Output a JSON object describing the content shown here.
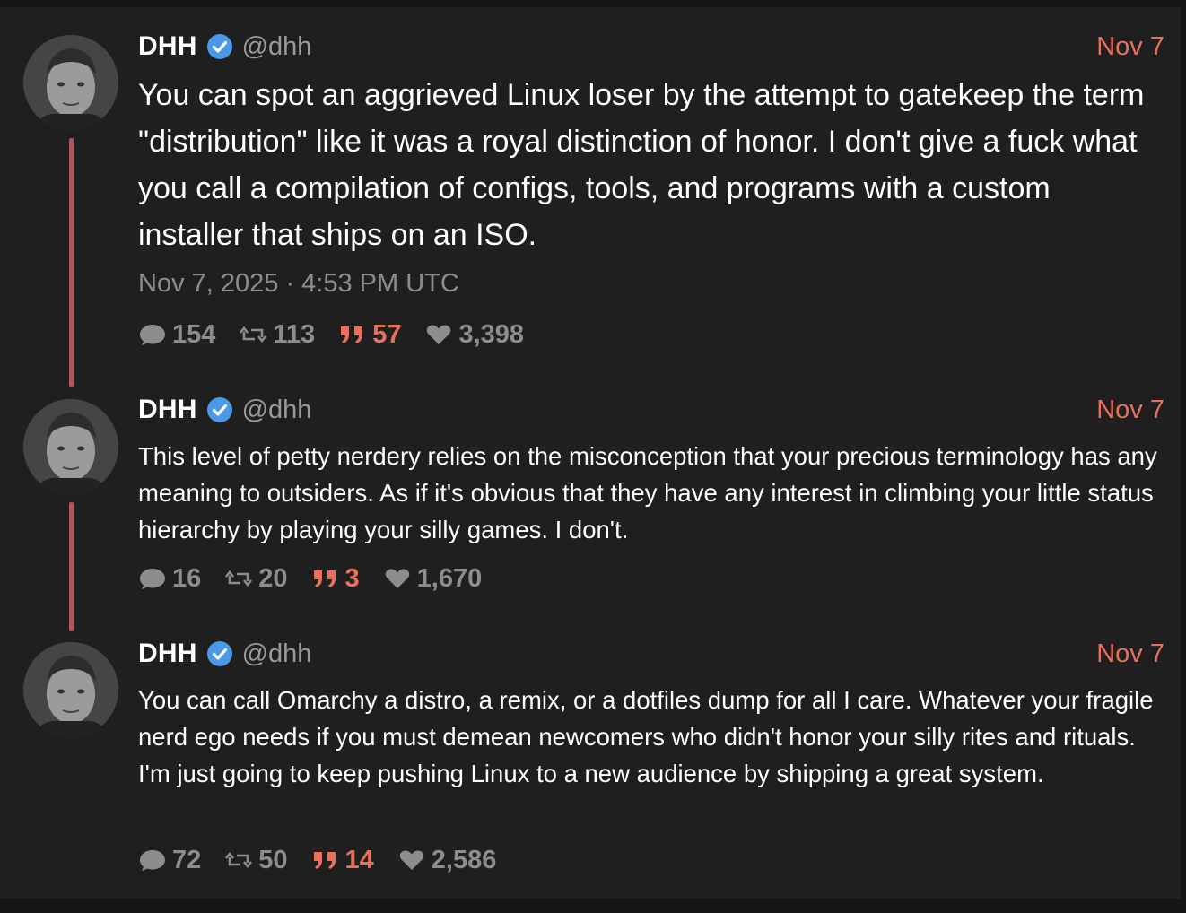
{
  "author": {
    "name": "DHH",
    "handle": "@dhh"
  },
  "accent_color": "#e8705d",
  "verified_color": "#4a99e9",
  "tweets": [
    {
      "date": "Nov 7",
      "text": "You can spot an aggrieved Linux loser by the attempt to gatekeep the term \"distribution\" like it was a royal distinction of honor. I don't give a fuck what you call a compilation of configs, tools, and programs with a custom installer that ships on an ISO.",
      "timestamp": "Nov 7, 2025 · 4:53 PM UTC",
      "stats": {
        "replies": "154",
        "retweets": "113",
        "quotes": "57",
        "likes": "3,398"
      }
    },
    {
      "date": "Nov 7",
      "text": "This level of petty nerdery relies on the misconception that your precious terminology has any meaning to outsiders. As if it's obvious that they have any interest in climbing your little status hierarchy by playing your silly games. I don't.",
      "stats": {
        "replies": "16",
        "retweets": "20",
        "quotes": "3",
        "likes": "1,670"
      }
    },
    {
      "date": "Nov 7",
      "text": "You can call Omarchy a distro, a remix, or a dotfiles dump for all I care. Whatever your fragile nerd ego needs if you must demean newcomers who didn't honor your silly rites and rituals. I'm just going to keep pushing Linux to a new audience by shipping a great system.",
      "stats": {
        "replies": "72",
        "retweets": "50",
        "quotes": "14",
        "likes": "2,586"
      }
    }
  ]
}
